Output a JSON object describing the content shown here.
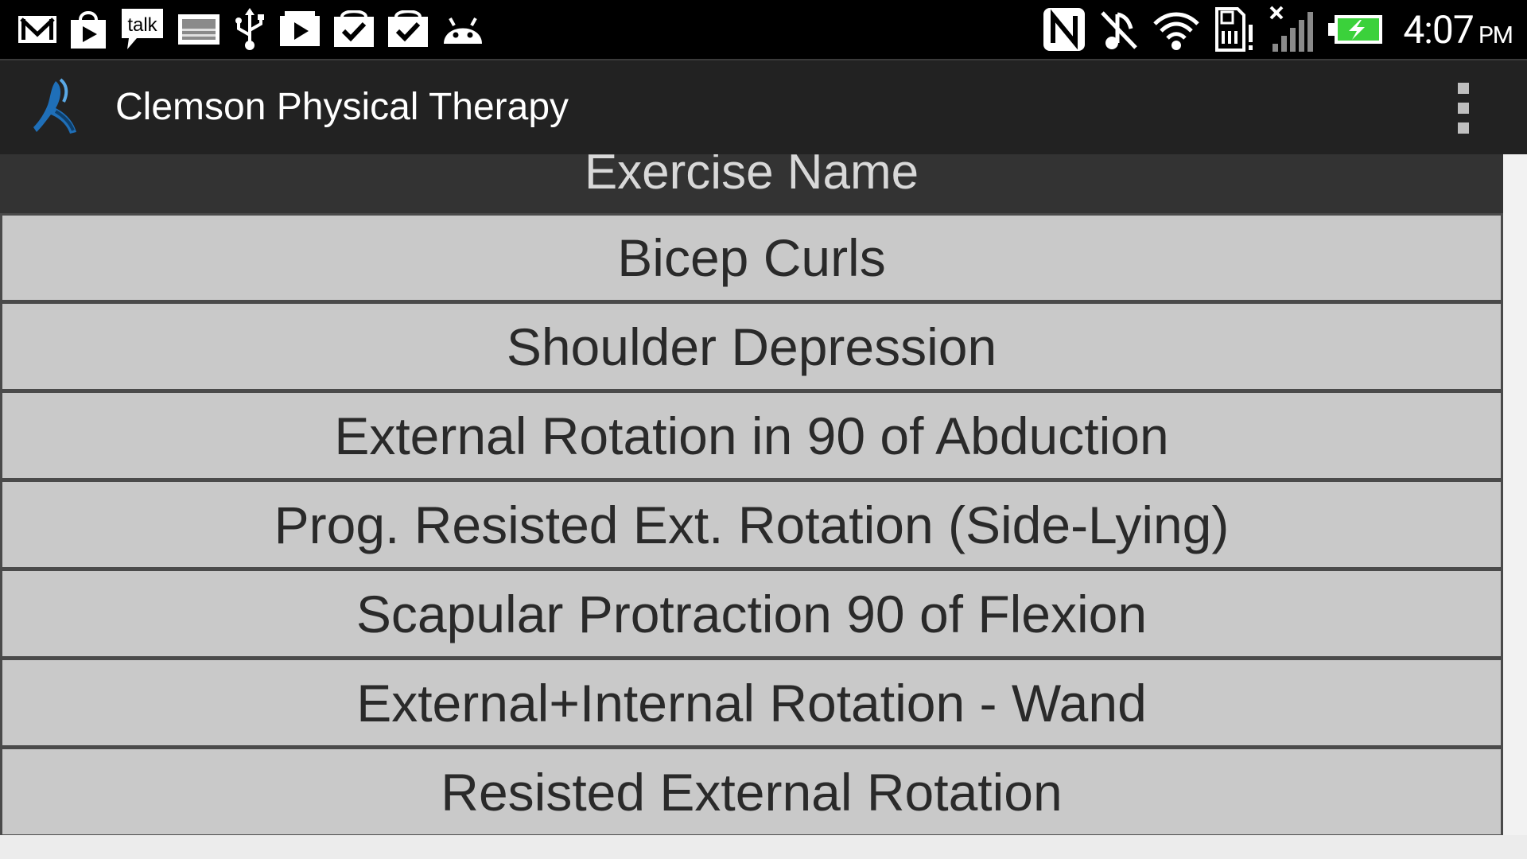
{
  "status_bar": {
    "time": "4:07",
    "ampm": "PM",
    "left_icons": [
      "gmail-icon",
      "play-store-bag-icon",
      "talk-icon",
      "gallery-icon",
      "usb-icon",
      "play-icon",
      "task-check-icon",
      "task-check-icon",
      "android-icon"
    ],
    "talk_label": "talk",
    "right_icons": [
      "nfc-icon",
      "muted-icon",
      "wifi-icon",
      "sd-card-alert-icon",
      "no-signal-icon",
      "battery-charging-icon"
    ],
    "battery_color": "#3bd13b"
  },
  "action_bar": {
    "title": "Clemson Physical Therapy",
    "logo": "runner-logo-icon",
    "overflow": "overflow-menu-icon"
  },
  "list": {
    "header": "Exercise Name",
    "items": [
      "Bicep Curls",
      "Shoulder Depression",
      "External Rotation in 90 of Abduction",
      "Prog. Resisted Ext. Rotation (Side-Lying)",
      "Scapular Protraction 90 of Flexion",
      "External+Internal Rotation - Wand",
      "Resisted External Rotation"
    ]
  },
  "colors": {
    "status_bar_bg": "#000000",
    "action_bar_bg": "#222222",
    "header_bg": "#333333",
    "row_bg": "#c9c9c9",
    "row_border": "#4a4a4a",
    "logo_blue": "#1f6fb8"
  }
}
